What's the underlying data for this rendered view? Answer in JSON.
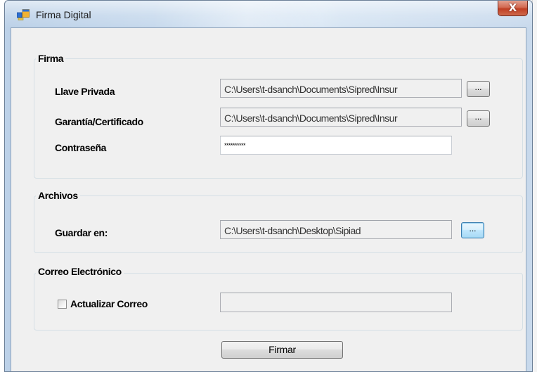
{
  "window": {
    "title": "Firma Digital",
    "close_glyph": "X"
  },
  "firma": {
    "group_label": "Firma",
    "llave_privada": {
      "label": "Llave Privada",
      "value": "C:\\Users\\t-dsanch\\Documents\\Sipred\\Insur",
      "browse_label": "..."
    },
    "certificado": {
      "label": "Garantía/Certificado",
      "value": "C:\\Users\\t-dsanch\\Documents\\Sipred\\Insur",
      "browse_label": "..."
    },
    "contrasena": {
      "label": "Contraseña",
      "masked_value": "**********"
    }
  },
  "archivos": {
    "group_label": "Archivos",
    "guardar_en": {
      "label": "Guardar en:",
      "value": "C:\\Users\\t-dsanch\\Desktop\\Sipiad",
      "browse_label": "..."
    }
  },
  "correo": {
    "group_label": "Correo Electrónico",
    "checkbox_label": "Actualizar Correo",
    "checked": false,
    "value": ""
  },
  "actions": {
    "submit_label": "Firmar"
  },
  "icons": {
    "app": "app-window-icon",
    "close": "close-icon"
  },
  "colors": {
    "titlebar": "#c9dbee",
    "client_background": "#f0f0f0",
    "close_button": "#c9452a",
    "focus_button": "#bee6fd"
  }
}
